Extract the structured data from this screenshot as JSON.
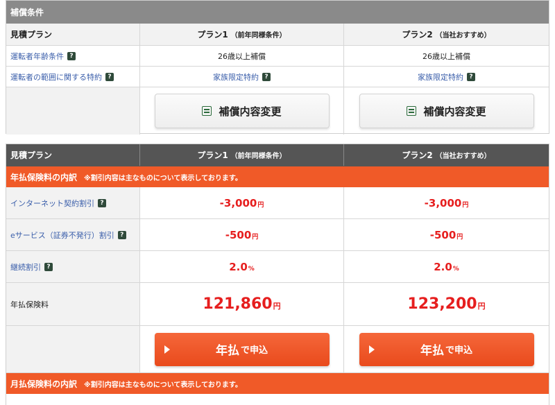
{
  "coverage": {
    "section_title": "補償条件",
    "header": {
      "label": "見積プラン",
      "plan1_name": "プラン1",
      "plan1_note": "（前年同様条件）",
      "plan2_name": "プラン2",
      "plan2_note": "（当社おすすめ）"
    },
    "rows": [
      {
        "label": "運転者年齢条件",
        "help": "?",
        "plan1": "26歳以上補償",
        "plan2": "26歳以上補償"
      },
      {
        "label": "運転者の範囲に関する特約",
        "help": "?",
        "plan1": "家族限定特約",
        "plan2": "家族限定特約"
      }
    ],
    "change_button_label": "補償内容変更"
  },
  "premium": {
    "header": {
      "label": "見積プラン",
      "plan1_name": "プラン1",
      "plan1_note": "（前年同様条件）",
      "plan2_name": "プラン2",
      "plan2_note": "（当社おすすめ）"
    },
    "annual_bar": {
      "title": "年払保険料の内訳",
      "note": "※割引内容は主なものについて表示しております。"
    },
    "discounts": [
      {
        "label": "インターネット契約割引",
        "help": "?",
        "plan1": "-3,000",
        "plan2": "-3,000",
        "unit": "円"
      },
      {
        "label": "eサービス（証券不発行）割引",
        "help": "?",
        "plan1": "-500",
        "plan2": "-500",
        "unit": "円"
      },
      {
        "label": "継続割引",
        "help": "?",
        "plan1": "2.0",
        "plan2": "2.0",
        "unit": "%"
      }
    ],
    "total": {
      "label": "年払保険料",
      "plan1": "121,860",
      "plan2": "123,200",
      "unit": "円"
    },
    "apply_button": {
      "big": "年払",
      "small": "で申込"
    },
    "monthly_bar": {
      "title": "月払保険料の内訳",
      "note": "※割引内容は主なものについて表示しております。"
    }
  }
}
